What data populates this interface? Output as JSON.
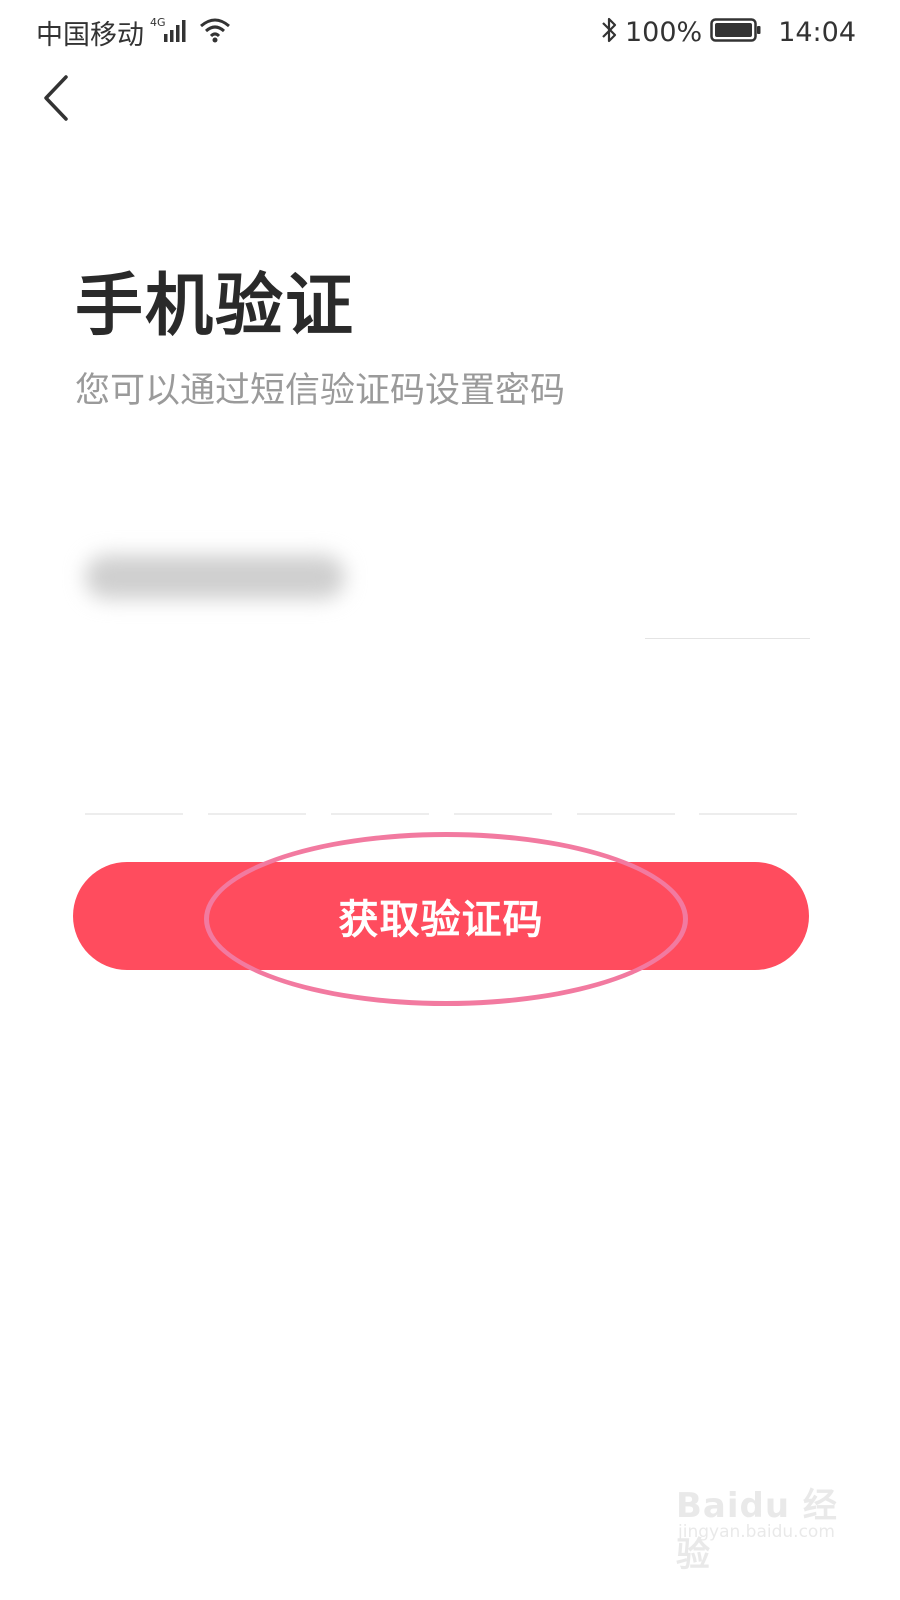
{
  "status_bar": {
    "carrier": "中国移动",
    "network_badge": "4G",
    "battery_percent": "100%",
    "time": "14:04",
    "icons": [
      "signal-icon",
      "wifi-icon",
      "bluetooth-icon",
      "battery-icon"
    ]
  },
  "nav": {
    "back_icon": "chevron-left-icon"
  },
  "page": {
    "title": "手机验证",
    "subtitle": "您可以通过短信验证码设置密码"
  },
  "form": {
    "phone_value_obscured": true,
    "code_box_count": 6
  },
  "button": {
    "label": "获取验证码",
    "color": "#ff4c5e"
  },
  "annotation": {
    "highlight_color": "#f27aa0"
  },
  "watermark": {
    "brand": "Baidu 经验",
    "url": "jingyan.baidu.com"
  }
}
